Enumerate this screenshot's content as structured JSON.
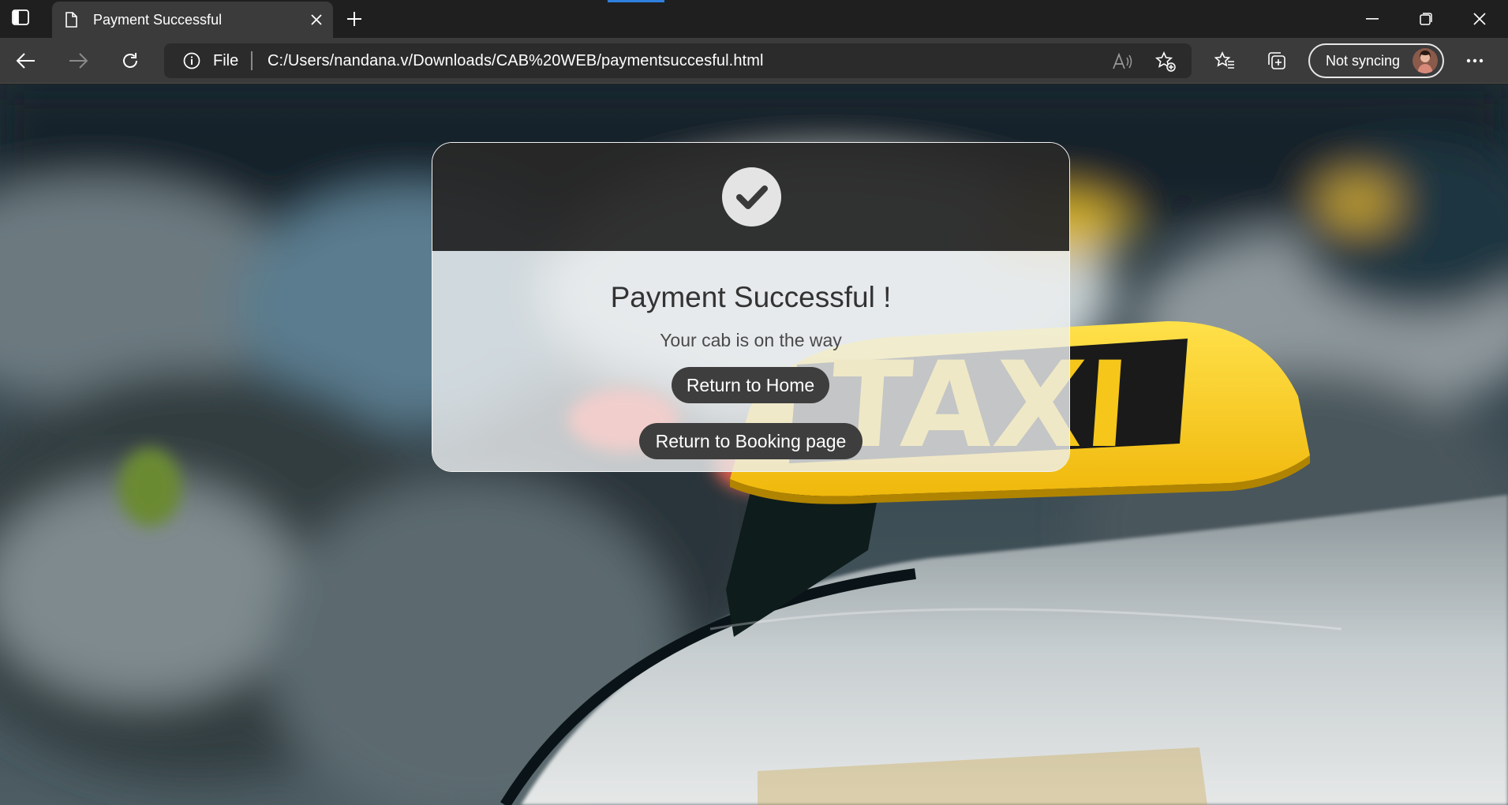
{
  "browser": {
    "tab": {
      "title": "Payment Successful"
    },
    "address": {
      "scheme": "File",
      "url": "C:/Users/nandana.v/Downloads/CAB%20WEB/paymentsuccesful.html"
    },
    "profile": {
      "sync_label": "Not syncing"
    },
    "icons": [
      "sidebar-icon",
      "page-icon",
      "close-icon",
      "plus-icon",
      "minimize-icon",
      "restore-icon",
      "close-window-icon",
      "back-icon",
      "forward-icon",
      "refresh-icon",
      "info-icon",
      "read-aloud-icon",
      "add-favorite-icon",
      "favorites-icon",
      "collections-icon",
      "more-icon"
    ]
  },
  "page": {
    "title": "Payment Successful !",
    "subtitle": "Your cab is on the way",
    "buttons": {
      "home": "Return to Home",
      "booking": "Return to Booking page"
    },
    "background_sign_text": "TAXI",
    "colors": {
      "header": "#282828",
      "button": "#3e3e3e",
      "taxi_yellow": "#f2c417"
    }
  }
}
